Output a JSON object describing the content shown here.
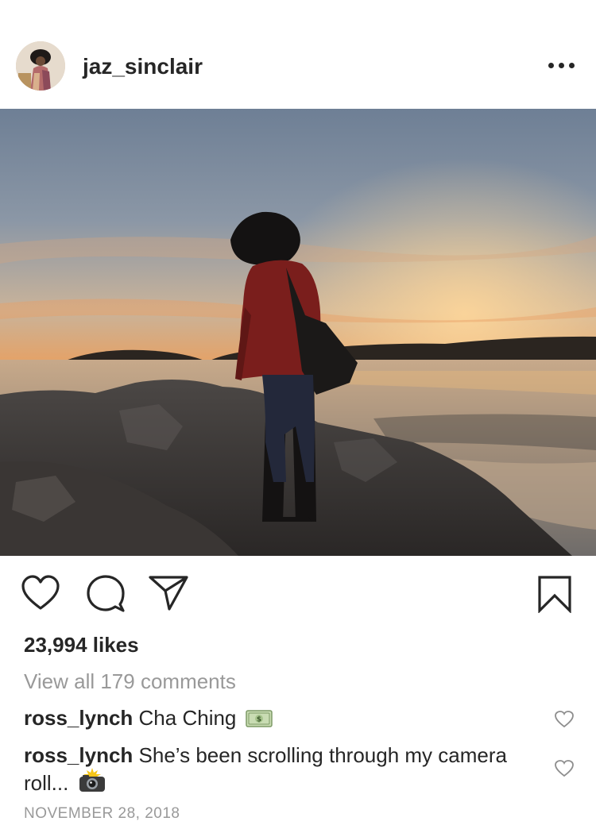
{
  "post": {
    "username": "jaz_sinclair",
    "more_icon": "more-horizontal-icon",
    "likes_text": "23,994 likes",
    "view_all_comments": "View all 179 comments",
    "comments": [
      {
        "user": "ross_lynch",
        "text": "Cha Ching",
        "emoji": "money-emoji"
      },
      {
        "user": "ross_lynch",
        "text": "She’s been scrolling through my camera roll...",
        "emoji": "camera-flash-emoji"
      }
    ],
    "date": "NOVEMBER 28, 2018"
  },
  "icons": {
    "like": "heart-icon",
    "comment": "comment-bubble-icon",
    "share": "paper-plane-icon",
    "save": "bookmark-icon"
  }
}
